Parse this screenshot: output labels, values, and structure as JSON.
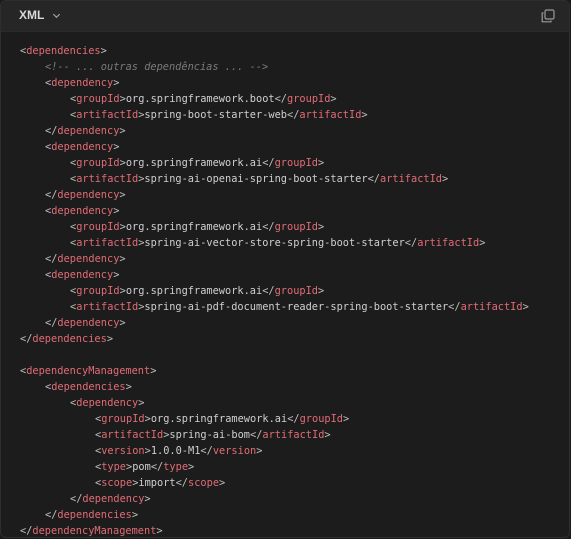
{
  "header": {
    "language": "XML",
    "copy_icon": "copy-icon",
    "chevron_icon": "chevron-down-icon"
  },
  "colors": {
    "background": "#1c1c1c",
    "header": "#262626",
    "tag": "#e06c75",
    "text": "#cccccc",
    "comment": "#7a7a7a"
  },
  "code_lines": [
    {
      "i": 0,
      "parts": [
        [
          "p",
          "<"
        ],
        [
          "t",
          "dependencies"
        ],
        [
          "p",
          ">"
        ]
      ]
    },
    {
      "i": 1,
      "parts": [
        [
          "c",
          "<!-- ... outras dependências ... -->"
        ]
      ]
    },
    {
      "i": 1,
      "parts": [
        [
          "p",
          "<"
        ],
        [
          "t",
          "dependency"
        ],
        [
          "p",
          ">"
        ]
      ]
    },
    {
      "i": 2,
      "parts": [
        [
          "p",
          "<"
        ],
        [
          "t",
          "groupId"
        ],
        [
          "p",
          ">"
        ],
        [
          "v",
          "org.springframework.boot"
        ],
        [
          "p",
          "</"
        ],
        [
          "t",
          "groupId"
        ],
        [
          "p",
          ">"
        ]
      ]
    },
    {
      "i": 2,
      "parts": [
        [
          "p",
          "<"
        ],
        [
          "t",
          "artifactId"
        ],
        [
          "p",
          ">"
        ],
        [
          "v",
          "spring-boot-starter-web"
        ],
        [
          "p",
          "</"
        ],
        [
          "t",
          "artifactId"
        ],
        [
          "p",
          ">"
        ]
      ]
    },
    {
      "i": 1,
      "parts": [
        [
          "p",
          "</"
        ],
        [
          "t",
          "dependency"
        ],
        [
          "p",
          ">"
        ]
      ]
    },
    {
      "i": 1,
      "parts": [
        [
          "p",
          "<"
        ],
        [
          "t",
          "dependency"
        ],
        [
          "p",
          ">"
        ]
      ]
    },
    {
      "i": 2,
      "parts": [
        [
          "p",
          "<"
        ],
        [
          "t",
          "groupId"
        ],
        [
          "p",
          ">"
        ],
        [
          "v",
          "org.springframework.ai"
        ],
        [
          "p",
          "</"
        ],
        [
          "t",
          "groupId"
        ],
        [
          "p",
          ">"
        ]
      ]
    },
    {
      "i": 2,
      "parts": [
        [
          "p",
          "<"
        ],
        [
          "t",
          "artifactId"
        ],
        [
          "p",
          ">"
        ],
        [
          "v",
          "spring-ai-openai-spring-boot-starter"
        ],
        [
          "p",
          "</"
        ],
        [
          "t",
          "artifactId"
        ],
        [
          "p",
          ">"
        ]
      ]
    },
    {
      "i": 1,
      "parts": [
        [
          "p",
          "</"
        ],
        [
          "t",
          "dependency"
        ],
        [
          "p",
          ">"
        ]
      ]
    },
    {
      "i": 1,
      "parts": [
        [
          "p",
          "<"
        ],
        [
          "t",
          "dependency"
        ],
        [
          "p",
          ">"
        ]
      ]
    },
    {
      "i": 2,
      "parts": [
        [
          "p",
          "<"
        ],
        [
          "t",
          "groupId"
        ],
        [
          "p",
          ">"
        ],
        [
          "v",
          "org.springframework.ai"
        ],
        [
          "p",
          "</"
        ],
        [
          "t",
          "groupId"
        ],
        [
          "p",
          ">"
        ]
      ]
    },
    {
      "i": 2,
      "parts": [
        [
          "p",
          "<"
        ],
        [
          "t",
          "artifactId"
        ],
        [
          "p",
          ">"
        ],
        [
          "v",
          "spring-ai-vector-store-spring-boot-starter"
        ],
        [
          "p",
          "</"
        ],
        [
          "t",
          "artifactId"
        ],
        [
          "p",
          ">"
        ]
      ]
    },
    {
      "i": 1,
      "parts": [
        [
          "p",
          "</"
        ],
        [
          "t",
          "dependency"
        ],
        [
          "p",
          ">"
        ]
      ]
    },
    {
      "i": 1,
      "parts": [
        [
          "p",
          "<"
        ],
        [
          "t",
          "dependency"
        ],
        [
          "p",
          ">"
        ]
      ]
    },
    {
      "i": 2,
      "parts": [
        [
          "p",
          "<"
        ],
        [
          "t",
          "groupId"
        ],
        [
          "p",
          ">"
        ],
        [
          "v",
          "org.springframework.ai"
        ],
        [
          "p",
          "</"
        ],
        [
          "t",
          "groupId"
        ],
        [
          "p",
          ">"
        ]
      ]
    },
    {
      "i": 2,
      "parts": [
        [
          "p",
          "<"
        ],
        [
          "t",
          "artifactId"
        ],
        [
          "p",
          ">"
        ],
        [
          "v",
          "spring-ai-pdf-document-reader-spring-boot-starter"
        ],
        [
          "p",
          "</"
        ],
        [
          "t",
          "artifactId"
        ],
        [
          "p",
          ">"
        ]
      ]
    },
    {
      "i": 1,
      "parts": [
        [
          "p",
          "</"
        ],
        [
          "t",
          "dependency"
        ],
        [
          "p",
          ">"
        ]
      ]
    },
    {
      "i": 0,
      "parts": [
        [
          "p",
          "</"
        ],
        [
          "t",
          "dependencies"
        ],
        [
          "p",
          ">"
        ]
      ]
    },
    {
      "i": 0,
      "parts": []
    },
    {
      "i": 0,
      "parts": [
        [
          "p",
          "<"
        ],
        [
          "t",
          "dependencyManagement"
        ],
        [
          "p",
          ">"
        ]
      ]
    },
    {
      "i": 1,
      "parts": [
        [
          "p",
          "<"
        ],
        [
          "t",
          "dependencies"
        ],
        [
          "p",
          ">"
        ]
      ]
    },
    {
      "i": 2,
      "parts": [
        [
          "p",
          "<"
        ],
        [
          "t",
          "dependency"
        ],
        [
          "p",
          ">"
        ]
      ]
    },
    {
      "i": 3,
      "parts": [
        [
          "p",
          "<"
        ],
        [
          "t",
          "groupId"
        ],
        [
          "p",
          ">"
        ],
        [
          "v",
          "org.springframework.ai"
        ],
        [
          "p",
          "</"
        ],
        [
          "t",
          "groupId"
        ],
        [
          "p",
          ">"
        ]
      ]
    },
    {
      "i": 3,
      "parts": [
        [
          "p",
          "<"
        ],
        [
          "t",
          "artifactId"
        ],
        [
          "p",
          ">"
        ],
        [
          "v",
          "spring-ai-bom"
        ],
        [
          "p",
          "</"
        ],
        [
          "t",
          "artifactId"
        ],
        [
          "p",
          ">"
        ]
      ]
    },
    {
      "i": 3,
      "parts": [
        [
          "p",
          "<"
        ],
        [
          "t",
          "version"
        ],
        [
          "p",
          ">"
        ],
        [
          "v",
          "1.0.0-M1"
        ],
        [
          "p",
          "</"
        ],
        [
          "t",
          "version"
        ],
        [
          "p",
          ">"
        ]
      ]
    },
    {
      "i": 3,
      "parts": [
        [
          "p",
          "<"
        ],
        [
          "t",
          "type"
        ],
        [
          "p",
          ">"
        ],
        [
          "v",
          "pom"
        ],
        [
          "p",
          "</"
        ],
        [
          "t",
          "type"
        ],
        [
          "p",
          ">"
        ]
      ]
    },
    {
      "i": 3,
      "parts": [
        [
          "p",
          "<"
        ],
        [
          "t",
          "scope"
        ],
        [
          "p",
          ">"
        ],
        [
          "v",
          "import"
        ],
        [
          "p",
          "</"
        ],
        [
          "t",
          "scope"
        ],
        [
          "p",
          ">"
        ]
      ]
    },
    {
      "i": 2,
      "parts": [
        [
          "p",
          "</"
        ],
        [
          "t",
          "dependency"
        ],
        [
          "p",
          ">"
        ]
      ]
    },
    {
      "i": 1,
      "parts": [
        [
          "p",
          "</"
        ],
        [
          "t",
          "dependencies"
        ],
        [
          "p",
          ">"
        ]
      ]
    },
    {
      "i": 0,
      "parts": [
        [
          "p",
          "</"
        ],
        [
          "t",
          "dependencyManagement"
        ],
        [
          "p",
          ">"
        ]
      ]
    }
  ]
}
